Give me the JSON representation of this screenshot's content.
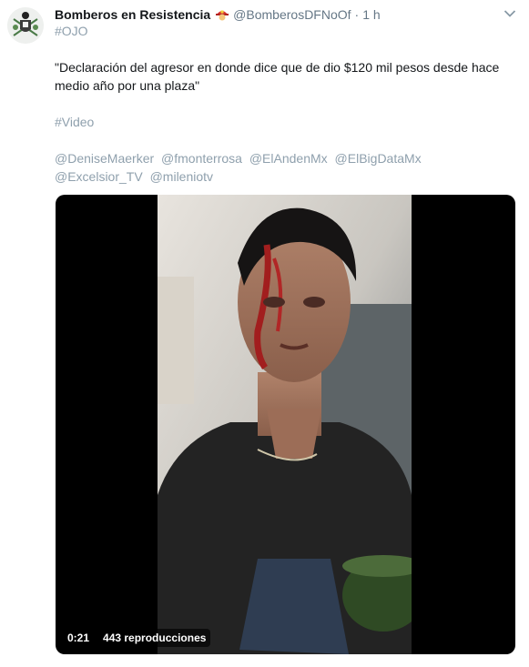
{
  "tweet": {
    "author_name": "Bomberos en Resistencia",
    "author_handle": "@BomberosDFNoOf",
    "separator": "·",
    "time": "1 h",
    "hashtag_top": "#OJO",
    "quote": "\"Declaración del agresor en donde dice que de dio $120 mil  pesos desde hace medio año por una plaza\"",
    "hashtag_video": "#Video",
    "mentions": [
      "@DeniseMaerker",
      "@fmonterrosa",
      "@ElAndenMx",
      "@ElBigDataMx",
      "@Excelsior_TV",
      "@mileniotv"
    ]
  },
  "media": {
    "duration": "0:21",
    "views": "443 reproducciones"
  },
  "icons": {
    "avatar": "firefighter-logo-icon",
    "name_emoji": "firefighter-emoji-icon",
    "menu": "chevron-down-icon"
  },
  "colors": {
    "link": "#8fa0ad",
    "secondary": "#657786",
    "text": "#14171a"
  }
}
